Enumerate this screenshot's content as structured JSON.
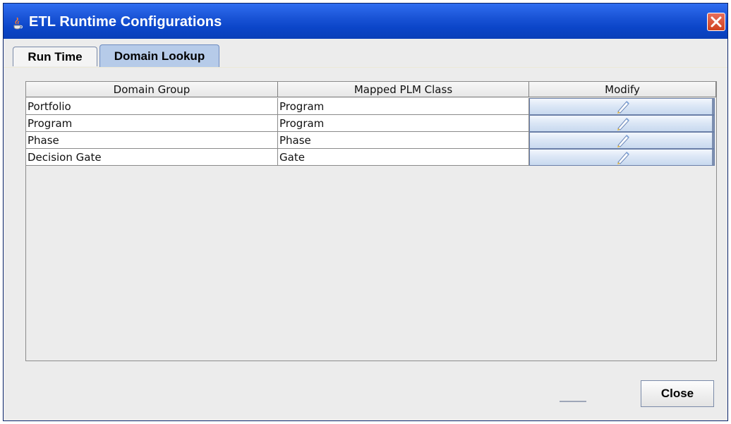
{
  "window": {
    "title": "ETL Runtime Configurations",
    "app_icon": "java-cup-icon",
    "close_icon": "close-icon"
  },
  "tabs": [
    {
      "label": "Run Time",
      "selected": false
    },
    {
      "label": "Domain Lookup",
      "selected": true
    }
  ],
  "table": {
    "columns": [
      "Domain Group",
      "Mapped PLM Class",
      "Modify"
    ],
    "rows": [
      {
        "domain_group": "Portfolio",
        "mapped_plm_class": "Program",
        "modify_icon": "edit-pen-icon"
      },
      {
        "domain_group": "Program",
        "mapped_plm_class": "Program",
        "modify_icon": "edit-pen-icon"
      },
      {
        "domain_group": "Phase",
        "mapped_plm_class": "Phase",
        "modify_icon": "edit-pen-icon"
      },
      {
        "domain_group": "Decision Gate",
        "mapped_plm_class": "Gate",
        "modify_icon": "edit-pen-icon"
      }
    ]
  },
  "footer": {
    "close_label": "Close"
  },
  "colors": {
    "titlebar": "#0b45c8",
    "selected_tab": "#b6cbe9",
    "button": "#dce7f6"
  }
}
